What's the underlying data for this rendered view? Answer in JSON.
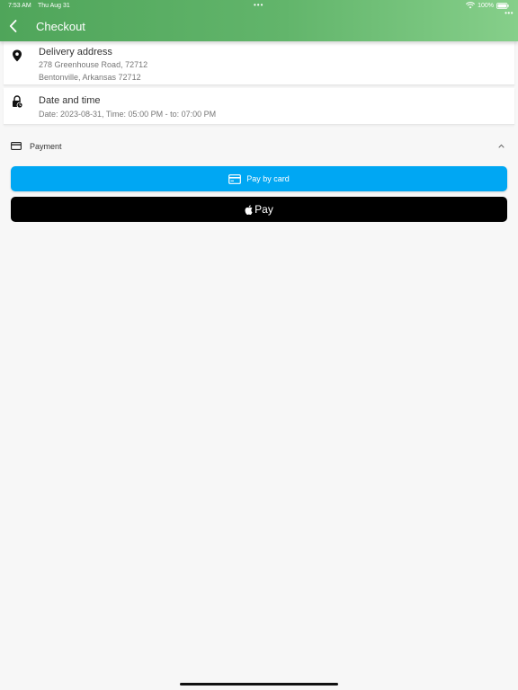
{
  "status_bar": {
    "time": "7:53 AM",
    "date": "Thu Aug 31",
    "dots": "•••",
    "battery": "100%",
    "more": "•••"
  },
  "header": {
    "title": "Checkout",
    "back_icon": "chevron-left-icon"
  },
  "delivery": {
    "icon": "location-pin-icon",
    "title": "Delivery address",
    "line1": "278 Greenhouse Road, 72712",
    "line2": "Bentonville, Arkansas 72712"
  },
  "datetime": {
    "icon": "lock-clock-icon",
    "title": "Date and time",
    "value": "Date: 2023-08-31, Time: 05:00 PM - to: 07:00 PM"
  },
  "payment": {
    "icon": "credit-card-icon",
    "label": "Payment",
    "expanded": true,
    "card_button_label": "Pay by card",
    "apple_button_label": "Pay"
  },
  "colors": {
    "header_start": "#4fa55a",
    "header_end": "#86cf8a",
    "pay_card": "#00a7f3",
    "apple_pay": "#000000",
    "background": "#f7f7f7"
  }
}
